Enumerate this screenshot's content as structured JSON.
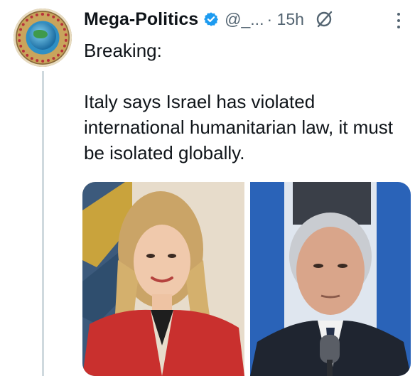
{
  "tweet": {
    "display_name": "Mega-Politics",
    "handle": "@_...",
    "separator": "·",
    "time": "15h",
    "text_line1": "Breaking:",
    "text_line2": "Italy says Israel has violated international humanitarian law, it must be isolated globally."
  },
  "icons": {
    "avatar": "globe-logo-avatar",
    "verified": "verified-badge-icon",
    "mute": "muted-icon",
    "more": "more-vertical-icon"
  },
  "colors": {
    "verified": "#1d9bf0",
    "text": "#0f1419",
    "secondary": "#536471"
  }
}
